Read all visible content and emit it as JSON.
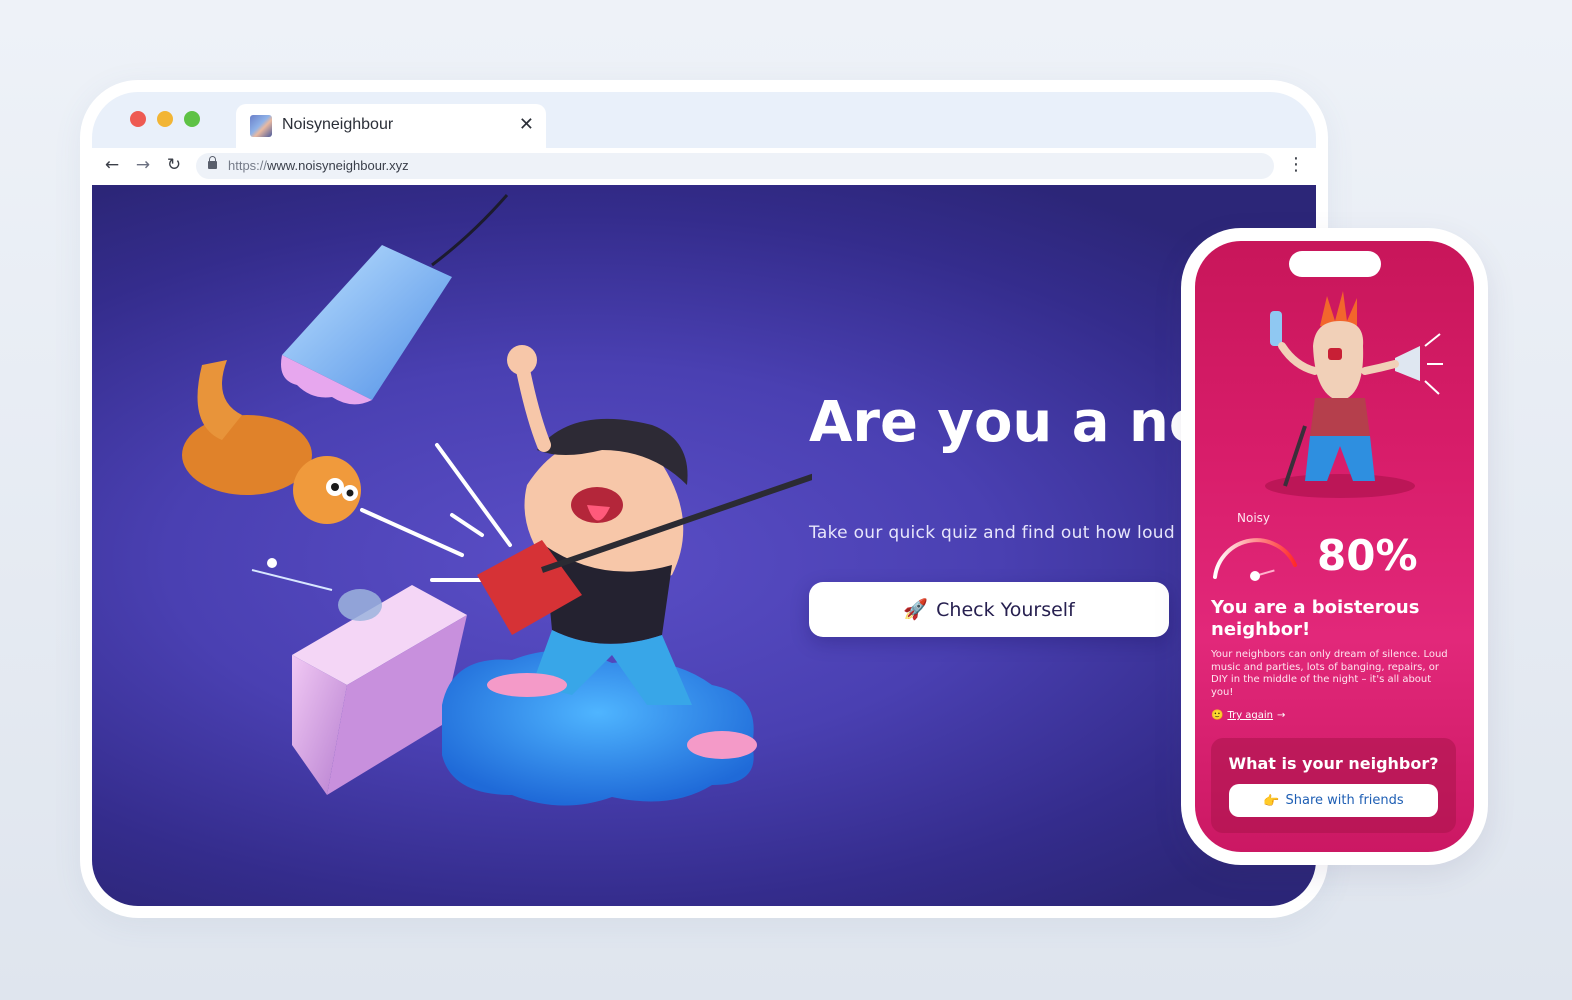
{
  "browser": {
    "tab_title": "Noisyneighbour",
    "tab_close": "✕",
    "url_scheme": "https://",
    "url_host": "www.noisyneighbour.xyz",
    "nav_back": "←",
    "nav_forward": "→",
    "nav_reload": "↻",
    "menu": "⋮",
    "window_buttons": {
      "close": "#ee5a52",
      "minimize": "#f2b535",
      "maximize": "#5ec245"
    }
  },
  "hero": {
    "title": "Are you a noisy neighbor?",
    "subtitle": "Take our quick quiz and find out how loud you are",
    "cta_icon": "🚀",
    "cta_label": "Check Yourself",
    "background_color": "#4a40b2"
  },
  "result": {
    "gauge_label": "Noisy",
    "percent_text": "80%",
    "noise_level": 0.8,
    "title": "You are a boisterous neighbor!",
    "description": "Your neighbors can only dream of silence. Loud music and parties, lots of banging, repairs, or DIY in the middle of the night – it's all about you!",
    "try_emoji": "🙂",
    "try_again_label": "Try again",
    "try_again_arrow": "→",
    "share_title": "What is your neighbor?",
    "share_icon": "👉",
    "share_label": "Share with friends",
    "background_color": "#d81d6a"
  }
}
